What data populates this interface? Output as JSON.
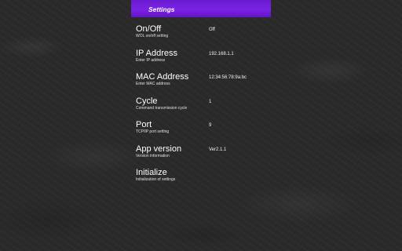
{
  "header": {
    "title": "Settings",
    "color": "#7a22e6"
  },
  "settings": [
    {
      "title": "On/Off",
      "subtitle": "WOL on/off setting",
      "value": "Off"
    },
    {
      "title": "IP Address",
      "subtitle": "Enter IP address",
      "value": "192.168.1.1"
    },
    {
      "title": "MAC Address",
      "subtitle": "Enter MAC address",
      "value": "12:34:56:78:9a:bc"
    },
    {
      "title": "Cycle",
      "subtitle": "Command transmission cycle",
      "value": "1"
    },
    {
      "title": "Port",
      "subtitle": "TCP/IP port setting",
      "value": "9"
    },
    {
      "title": "App version",
      "subtitle": "Version information",
      "value": "Ver2.1.1"
    },
    {
      "title": "Initialize",
      "subtitle": "Initialization of settings",
      "value": ""
    }
  ]
}
